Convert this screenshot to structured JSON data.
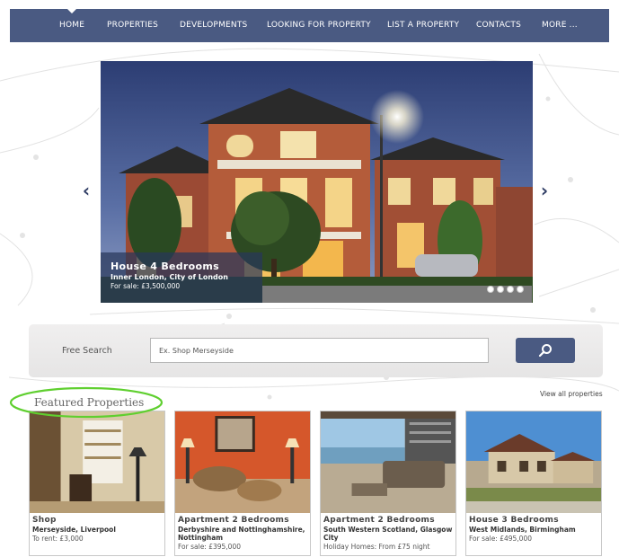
{
  "nav": {
    "items": [
      {
        "label": "HOME"
      },
      {
        "label": "PROPERTIES"
      },
      {
        "label": "DEVELOPMENTS"
      },
      {
        "label": "LOOKING FOR PROPERTY"
      },
      {
        "label": "LIST A PROPERTY"
      },
      {
        "label": "CONTACTS"
      },
      {
        "label": "MORE ..."
      }
    ]
  },
  "slider": {
    "title": "House 4 Bedrooms",
    "location": "Inner London, City of London",
    "price": "For sale: £3,500,000",
    "prev_icon": "chevron-left-icon",
    "next_icon": "chevron-right-icon",
    "dot_count": 4
  },
  "search": {
    "label": "Free Search",
    "placeholder": "Ex. Shop Merseyside",
    "button_icon": "search-icon"
  },
  "featured": {
    "title": "Featured Properties",
    "view_all": "View all properties",
    "cards": [
      {
        "title": "Shop",
        "location": "Merseyside, Liverpool",
        "price": "To rent: £3,000"
      },
      {
        "title": "Apartment 2 Bedrooms",
        "location": "Derbyshire and Nottinghamshire, Nottingham",
        "price": "For sale: £395,000"
      },
      {
        "title": "Apartment 2 Bedrooms",
        "location": "South Western Scotland, Glasgow City",
        "price": "Holiday Homes: From £75 night"
      },
      {
        "title": "House 3 Bedrooms",
        "location": "West Midlands, Birmingham",
        "price": "For sale: £495,000"
      }
    ]
  },
  "colors": {
    "nav_bg": "#4a5a82",
    "caption_bg": "#28375a",
    "highlight_ellipse": "#5fcf2f"
  }
}
